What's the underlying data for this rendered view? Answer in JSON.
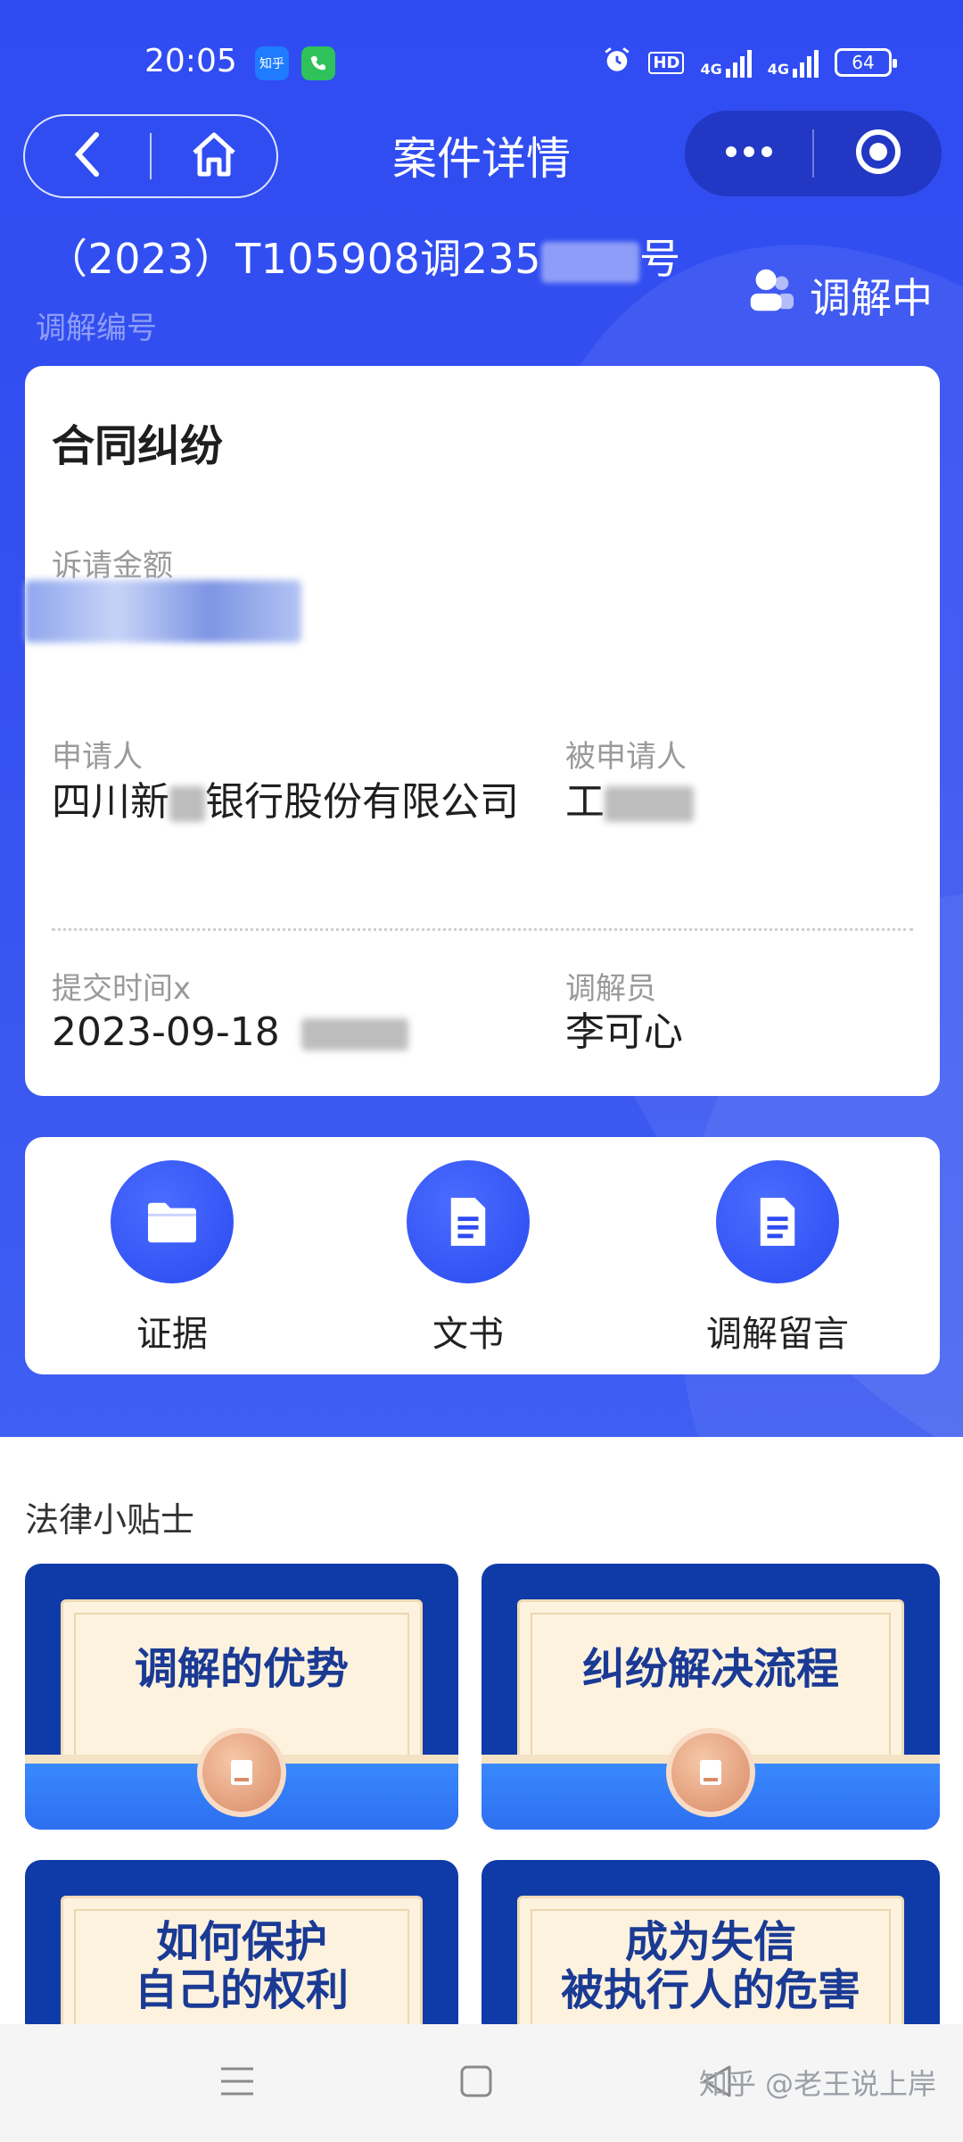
{
  "status_bar": {
    "time": "20:05",
    "apps": [
      "知乎",
      "phone-app"
    ],
    "hd_label": "HD",
    "net1": "4G",
    "net2": "4G",
    "battery": "64"
  },
  "nav": {
    "title": "案件详情",
    "back_icon": "chevron-left-icon",
    "home_icon": "home-icon",
    "more_icon": "more-dots-icon",
    "close_icon": "target-icon"
  },
  "case": {
    "number_prefix": "（2023）T105908调235",
    "number_suffix": "号",
    "number_label": "调解编号",
    "status": "调解中"
  },
  "detail_card": {
    "title": "合同纠纷",
    "amount_label": "诉请金额",
    "applicant_label": "申请人",
    "applicant_value_a": "四川新",
    "applicant_value_b": "银行股份有限公司",
    "respondent_label": "被申请人",
    "respondent_value": "工",
    "submit_time_label": "提交时间x",
    "submit_time_value": "2023-09-18",
    "mediator_label": "调解员",
    "mediator_value": "李可心"
  },
  "actions": [
    {
      "label": "证据",
      "icon": "folder-icon"
    },
    {
      "label": "文书",
      "icon": "document-icon"
    },
    {
      "label": "调解留言",
      "icon": "document-icon"
    }
  ],
  "tips": {
    "title": "法律小贴士",
    "items": [
      {
        "line1": "调解的优势",
        "line2": ""
      },
      {
        "line1": "纠纷解决流程",
        "line2": ""
      },
      {
        "line1": "如何保护",
        "line2": "自己的权利"
      },
      {
        "line1": "成为失信",
        "line2": "被执行人的危害"
      }
    ]
  },
  "watermark": "知乎 @老王说上岸",
  "colors": {
    "primary": "#2f4cf2",
    "nav_pill": "#2238c4",
    "tip_bg": "#0f3ba8",
    "tip_text": "#1a3a94"
  }
}
